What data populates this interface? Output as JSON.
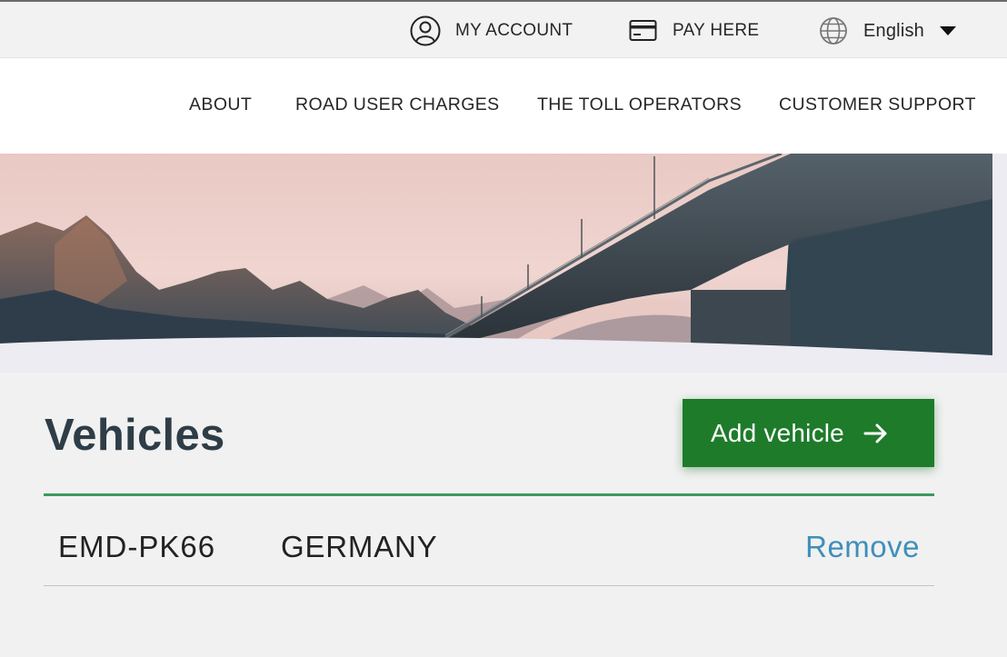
{
  "topbar": {
    "account_label": "MY ACCOUNT",
    "pay_label": "PAY HERE",
    "language_label": "English",
    "icons": {
      "account": "user-circle-icon",
      "pay": "credit-card-icon",
      "language": "globe-icon",
      "dropdown": "caret-down-icon"
    }
  },
  "nav": {
    "items": [
      {
        "label": "ABOUT"
      },
      {
        "label": "ROAD USER CHARGES"
      },
      {
        "label": "THE TOLL OPERATORS"
      },
      {
        "label": "CUSTOMER SUPPORT"
      }
    ]
  },
  "vehicles": {
    "title": "Vehicles",
    "add_button_label": "Add vehicle",
    "rows": [
      {
        "plate": "EMD-PK66",
        "country": "GERMANY",
        "action_label": "Remove"
      }
    ]
  },
  "colors": {
    "primary_button": "#1e7b2a",
    "divider_accent": "#3c9a5a",
    "link": "#3f8fba",
    "heading": "#2e3d47"
  }
}
